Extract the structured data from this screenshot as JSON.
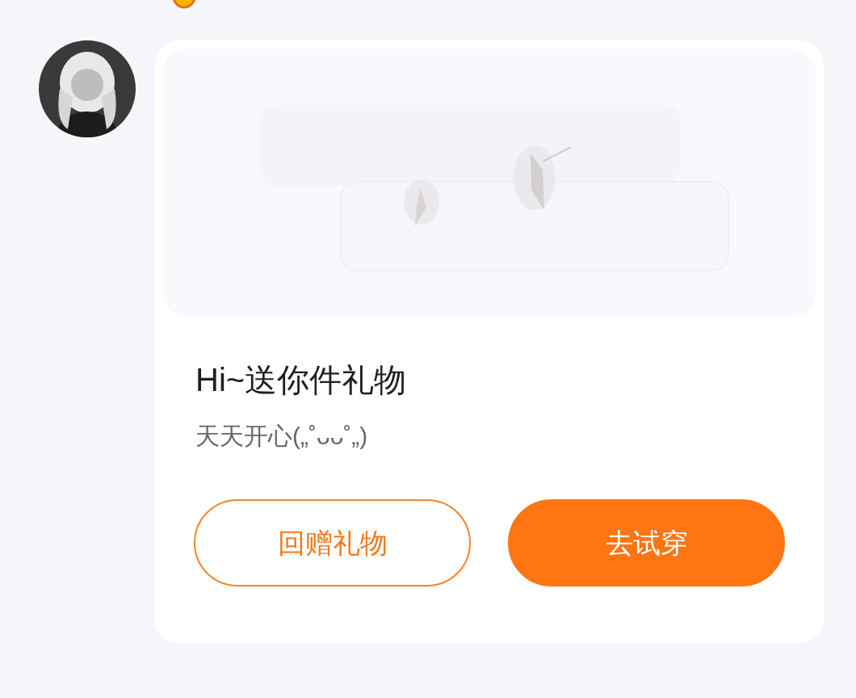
{
  "card": {
    "title": "Hi~送你件礼物",
    "message": "天天开心(„˚ᴗᴗ˚„)"
  },
  "buttons": [
    {
      "label": "回赠礼物",
      "kind": "outline"
    },
    {
      "label": "去试穿",
      "kind": "filled"
    }
  ]
}
